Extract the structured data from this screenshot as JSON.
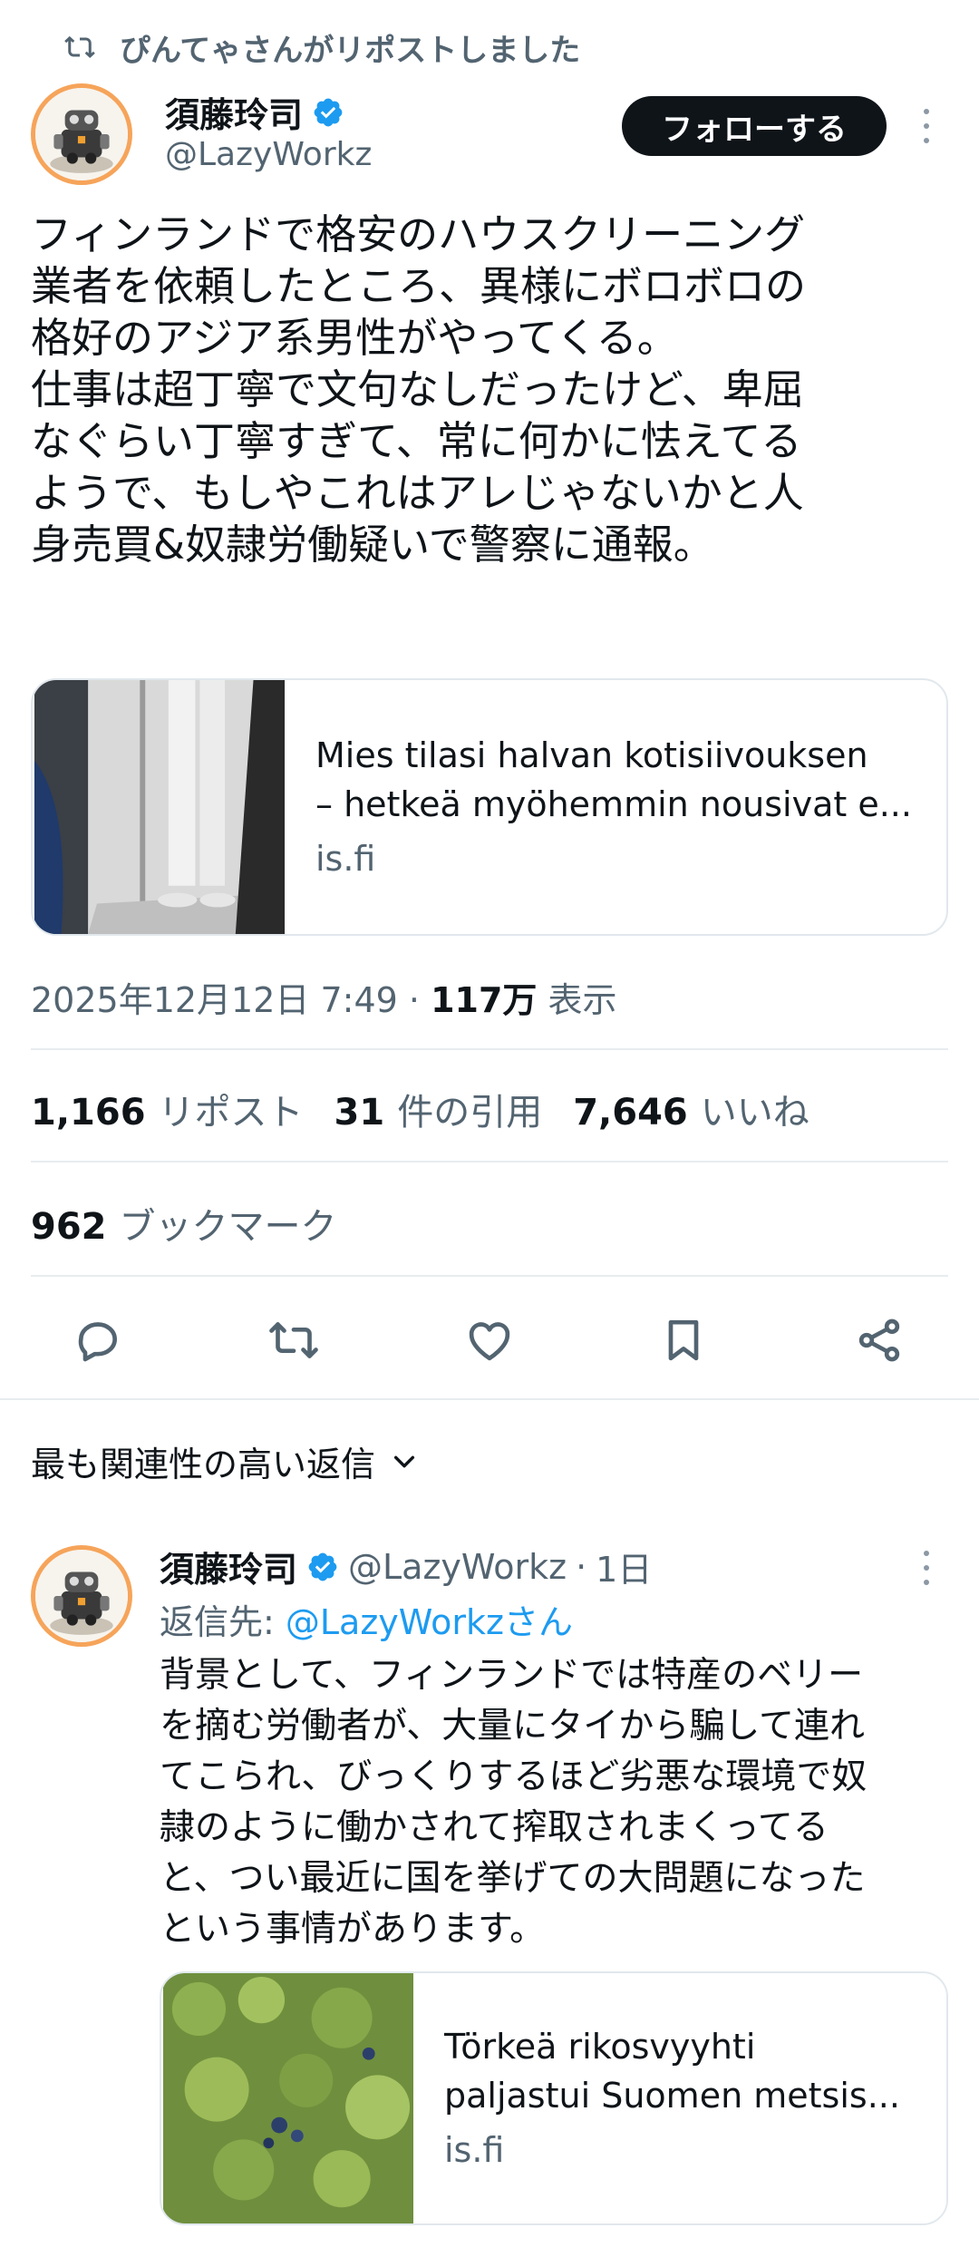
{
  "repost": {
    "icon": "repost-icon",
    "text": "ぴんてゃさんがリポストしました"
  },
  "tweet": {
    "author_name": "須藤玲司",
    "author_handle": "@LazyWorkz",
    "follow_label": "フォローする",
    "text": "フィンランドで格安のハウスクリーニング\n業者を依頼したところ、異様にボロボロの\n格好のアジア系男性がやってくる。\n仕事は超丁寧で文句なしだったけど、卑屈\nなぐらい丁寧すぎて、常に何かに怯えてる\nようで、もしやこれはアレじゃないかと人\n身売買&奴隷労働疑いで警察に通報。",
    "card": {
      "title_line1": "Mies tilasi halvan kotisiivouksen",
      "title_line2": "– hetkeä myöhemmin nousivat e...",
      "domain": "is.fi"
    },
    "timestamp": "2025年12月12日 7:49 · ",
    "views_count": "117万",
    "views_label": " 表示",
    "stats": {
      "reposts_count": "1,166",
      "reposts_label": "リポスト",
      "quotes_count": "31",
      "quotes_label": "件の引用",
      "likes_count": "7,646",
      "likes_label": "いいね",
      "bookmarks_count": "962",
      "bookmarks_label": "ブックマーク"
    }
  },
  "sort": {
    "label": "最も関連性の高い返信"
  },
  "reply": {
    "author_name": "須藤玲司",
    "author_handle": "@LazyWorkz",
    "age": "1日",
    "reply_to_prefix": "返信先: ",
    "reply_to_handle": "@LazyWorkzさん",
    "text": "背景として、フィンランドでは特産のベリー\nを摘む労働者が、大量にタイから騙して連れ\nてこられ、びっくりするほど劣悪な環境で奴\n隷のように働かされて搾取されまくってる\nと、つい最近に国を挙げての大問題になった\nという事情があります。",
    "card": {
      "title_line1": "Törkeä rikosvyyhti",
      "title_line2": "paljastui Suomen metsis...",
      "domain": "is.fi"
    }
  },
  "colors": {
    "text": "#0f1419",
    "secondary": "#536471",
    "link": "#1d9bf0",
    "verified": "#1d9bf0",
    "follow_bg": "#0f1419",
    "avatar_ring": "#f6a45a"
  },
  "icons": [
    "repost-icon",
    "verified-badge-icon",
    "more-vertical-icon",
    "reply-icon",
    "retweet-icon",
    "like-icon",
    "bookmark-icon",
    "share-icon",
    "chevron-down-icon"
  ]
}
